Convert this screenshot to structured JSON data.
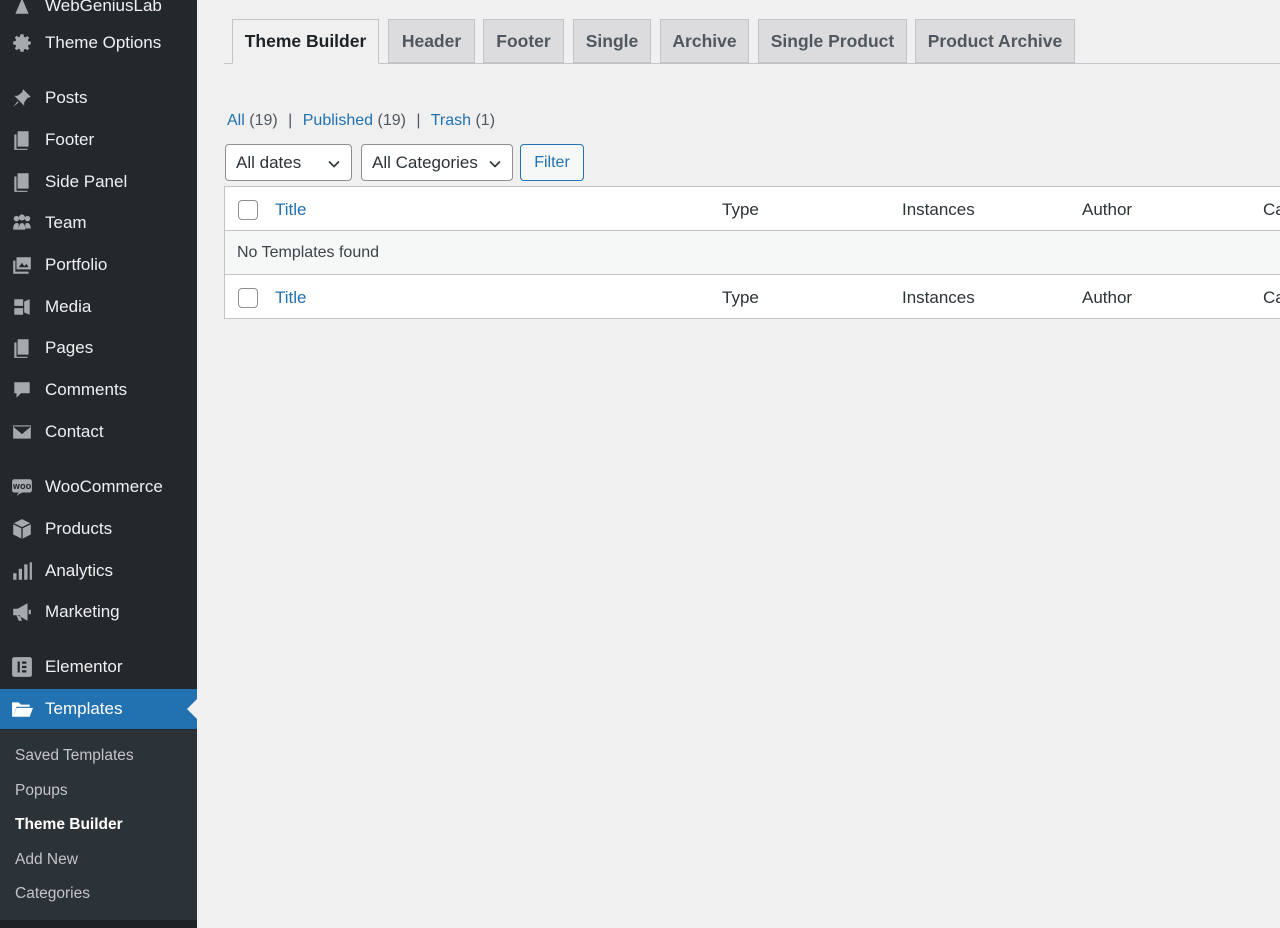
{
  "sidebar": {
    "site_name": "WebGeniusLab",
    "items": [
      {
        "label": "Theme Options",
        "icon": "gear-icon"
      },
      {
        "label": "Posts",
        "icon": "pin-icon"
      },
      {
        "label": "Footer",
        "icon": "pages-icon"
      },
      {
        "label": "Side Panel",
        "icon": "pages-icon"
      },
      {
        "label": "Team",
        "icon": "team-icon"
      },
      {
        "label": "Portfolio",
        "icon": "portfolio-icon"
      },
      {
        "label": "Media",
        "icon": "media-icon"
      },
      {
        "label": "Pages",
        "icon": "pages-icon"
      },
      {
        "label": "Comments",
        "icon": "comment-icon"
      },
      {
        "label": "Contact",
        "icon": "mail-icon"
      },
      {
        "label": "WooCommerce",
        "icon": "woo-icon"
      },
      {
        "label": "Products",
        "icon": "box-icon"
      },
      {
        "label": "Analytics",
        "icon": "bar-chart-icon"
      },
      {
        "label": "Marketing",
        "icon": "megaphone-icon"
      },
      {
        "label": "Elementor",
        "icon": "elementor-icon"
      },
      {
        "label": "Templates",
        "icon": "folder-icon"
      }
    ],
    "submenu": [
      "Saved Templates",
      "Popups",
      "Theme Builder",
      "Add New",
      "Categories"
    ],
    "current_submenu": "Theme Builder"
  },
  "tabs": [
    "Theme Builder",
    "Header",
    "Footer",
    "Single",
    "Archive",
    "Single Product",
    "Product Archive"
  ],
  "views": {
    "all_label": "All",
    "all_count": "(19)",
    "published_label": "Published",
    "published_count": "(19)",
    "trash_label": "Trash",
    "trash_count": "(1)",
    "separator": "|"
  },
  "filters": {
    "dates": "All dates",
    "categories": "All Categories",
    "button": "Filter"
  },
  "table": {
    "columns": [
      "Title",
      "Type",
      "Instances",
      "Author",
      "Ca"
    ],
    "empty_message": "No Templates found"
  },
  "colors": {
    "sidebar_bg": "#23282d",
    "accent": "#2271b1",
    "page_bg": "#f0f0f1"
  }
}
